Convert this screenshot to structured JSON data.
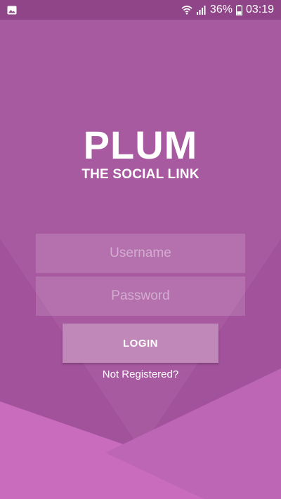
{
  "status_bar": {
    "notification_icon": "image-icon",
    "wifi_icon": "wifi-icon",
    "signal_icon": "signal-icon",
    "battery_icon": "battery-icon",
    "battery_percent": "36%",
    "time": "03:19"
  },
  "brand": {
    "title": "PLUM",
    "subtitle": "THE SOCIAL LINK"
  },
  "login_form": {
    "username_placeholder": "Username",
    "username_value": "",
    "password_placeholder": "Password",
    "password_value": "",
    "login_label": "LOGIN",
    "register_link": "Not Registered?"
  },
  "colors": {
    "background": "#a2529b",
    "status_bar": "#8f4588",
    "top_shape": "#a85aa1",
    "bottom_left_shape": "#c96cbd",
    "bottom_right_shape": "#bd66b6",
    "button": "#bf88b9"
  }
}
